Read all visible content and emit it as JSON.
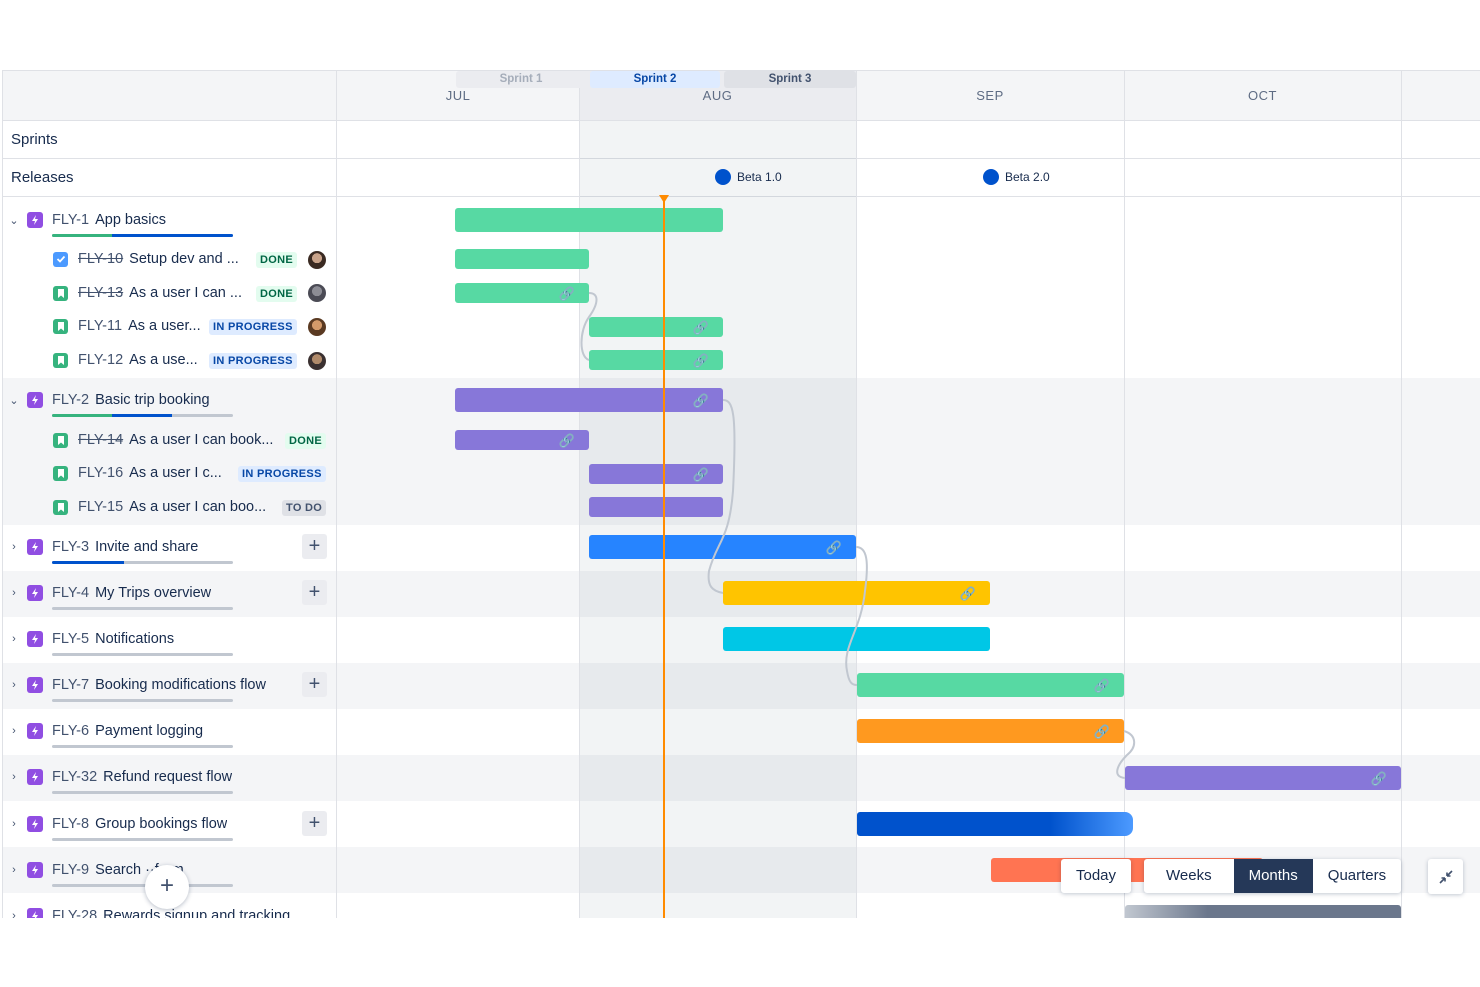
{
  "months": [
    "JUL",
    "AUG",
    "SEP",
    "OCT"
  ],
  "rows": {
    "sprints_label": "Sprints",
    "releases_label": "Releases"
  },
  "sprints": [
    {
      "label": "Sprint 1",
      "state": "closed"
    },
    {
      "label": "Sprint 2",
      "state": "active"
    },
    {
      "label": "Sprint 3",
      "state": "future"
    }
  ],
  "releases": [
    {
      "label": "Beta 1.0"
    },
    {
      "label": "Beta 2.0"
    }
  ],
  "epics": [
    {
      "key": "FLY-1",
      "title": "App basics",
      "expanded": true,
      "color": "#57D9A3",
      "children": [
        {
          "key": "FLY-10",
          "title": "Setup dev and ...",
          "status": "DONE",
          "resolved": true,
          "type": "task"
        },
        {
          "key": "FLY-13",
          "title": "As a user I can ...",
          "status": "DONE",
          "resolved": true,
          "type": "story"
        },
        {
          "key": "FLY-11",
          "title": "As a user...",
          "status": "IN PROGRESS",
          "resolved": false,
          "type": "story"
        },
        {
          "key": "FLY-12",
          "title": "As a use...",
          "status": "IN PROGRESS",
          "resolved": false,
          "type": "story"
        }
      ]
    },
    {
      "key": "FLY-2",
      "title": "Basic trip booking",
      "expanded": true,
      "color": "#8777D9",
      "children": [
        {
          "key": "FLY-14",
          "title": "As a user I can book...",
          "status": "DONE",
          "resolved": true,
          "type": "story"
        },
        {
          "key": "FLY-16",
          "title": "As a user I c...",
          "status": "IN PROGRESS",
          "resolved": false,
          "type": "story"
        },
        {
          "key": "FLY-15",
          "title": "As a user I can boo...",
          "status": "TO DO",
          "resolved": false,
          "type": "story"
        }
      ]
    },
    {
      "key": "FLY-3",
      "title": "Invite and share",
      "color": "#2684FF"
    },
    {
      "key": "FLY-4",
      "title": "My Trips overview",
      "color": "#FFC400"
    },
    {
      "key": "FLY-5",
      "title": "Notifications",
      "color": "#00C7E6"
    },
    {
      "key": "FLY-7",
      "title": "Booking modifications flow",
      "color": "#57D9A3"
    },
    {
      "key": "FLY-6",
      "title": "Payment logging",
      "color": "#FF991F"
    },
    {
      "key": "FLY-32",
      "title": "Refund request flow",
      "color": "#8777D9"
    },
    {
      "key": "FLY-8",
      "title": "Group bookings flow",
      "color": "#0052CC"
    },
    {
      "key": "FLY-9",
      "title": "Search ··form",
      "color": "#FF7452"
    },
    {
      "key": "FLY-28",
      "title": "Rewards signup and tracking",
      "color": "#6B778C"
    }
  ],
  "controls": {
    "today": "Today",
    "views": [
      "Weeks",
      "Months",
      "Quarters"
    ],
    "active_view": "Months"
  },
  "fab_label": "+",
  "plus_label": "+"
}
